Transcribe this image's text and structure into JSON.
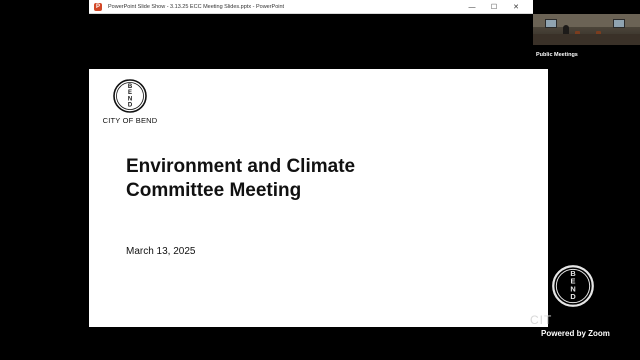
{
  "window": {
    "app_icon": "powerpoint-icon",
    "title": "PowerPoint Slide Show  -  3.13.25 ECC Meeting Slides.pptx  -  PowerPoint",
    "minimize_glyph": "—",
    "maximize_glyph": "☐",
    "close_glyph": "✕"
  },
  "slide": {
    "logo_text": "BEND",
    "org_name": "CITY OF BEND",
    "title_line1": "Environment and Climate",
    "title_line2": "Committee Meeting",
    "date": "March 13, 2025"
  },
  "zoom": {
    "participant_name": "Public Meetings",
    "watermark_logo_text": "BEND",
    "watermark_text": "CIT",
    "powered_by": "Powered by Zoom"
  },
  "colors": {
    "background": "#000000",
    "slide_bg": "#ffffff",
    "ppt_brand": "#d24726"
  }
}
